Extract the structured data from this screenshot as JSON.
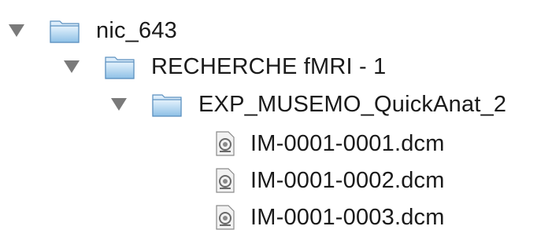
{
  "tree": {
    "root": {
      "label": "nic_643",
      "icon": "folder-icon",
      "expanded": true,
      "children": [
        {
          "label": "RECHERCHE fMRI - 1",
          "icon": "folder-icon",
          "expanded": true,
          "children": [
            {
              "label": "EXP_MUSEMO_QuickAnat_2",
              "icon": "folder-icon",
              "expanded": true,
              "files": [
                {
                  "label": "IM-0001-0001.dcm",
                  "icon": "dicom-file-icon"
                },
                {
                  "label": "IM-0001-0002.dcm",
                  "icon": "dicom-file-icon"
                },
                {
                  "label": "IM-0001-0003.dcm",
                  "icon": "dicom-file-icon"
                }
              ]
            }
          ]
        }
      ]
    }
  },
  "colors": {
    "disclosure": "#7a7a7a",
    "folder_light": "#d9ecfb",
    "folder_dark": "#7fb3dd",
    "folder_stroke": "#5a8fbf",
    "text": "#1a1a1a"
  }
}
